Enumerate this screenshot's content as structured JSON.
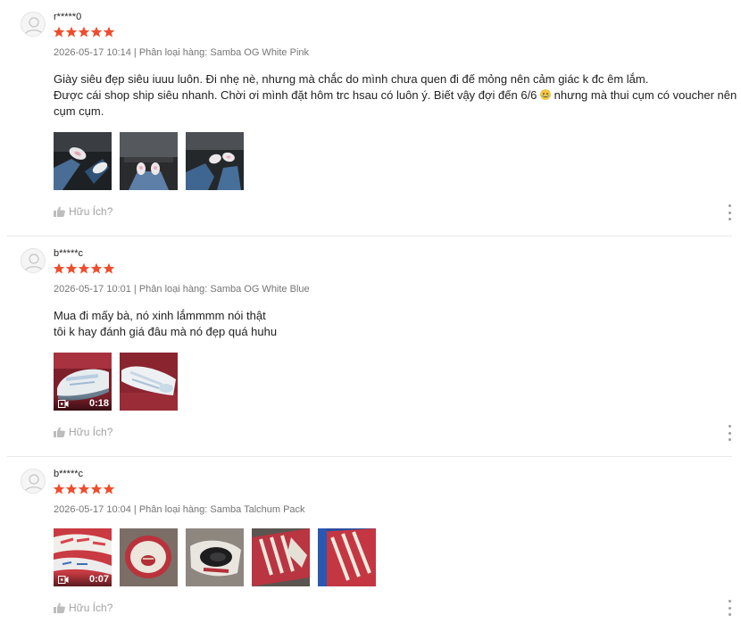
{
  "colors": {
    "star": "#ee4d2d",
    "meta": "#757575",
    "helpful": "#a3a3a3"
  },
  "reviews": [
    {
      "username": "r*****0",
      "rating": 5,
      "date": "2026-05-17 10:14",
      "separator": "|",
      "variation_label": "Phân loại hàng:",
      "variation": "Samba OG White Pink",
      "lines": [
        "Giày siêu đẹp siêu iuuu luôn. Đi nhẹ nè, nhưng mà chắc do mình chưa quen đi đế mỏng nên cảm giác k đc êm lắm.",
        "Được cái shop ship siêu nhanh. Chời ơi mình đặt hôm trc hsau có luôn ý. Biết vậy đợi đến 6/6",
        "cụm cụm."
      ],
      "line2_tail": " nhưng mà thui cụm có voucher nên",
      "emoji": "crying-face",
      "media": [
        {
          "type": "image",
          "name": "photo-sneakers-car-1"
        },
        {
          "type": "image",
          "name": "photo-sneakers-car-2"
        },
        {
          "type": "image",
          "name": "photo-sneakers-car-3"
        }
      ],
      "helpful_label": "Hữu Ích?"
    },
    {
      "username": "b*****c",
      "rating": 5,
      "date": "2026-05-17 10:01",
      "separator": "|",
      "variation_label": "Phân loại hàng:",
      "variation": "Samba OG White Blue",
      "lines": [
        "Mua đi mấy bà, nó xinh lắmmmm nói thật",
        "tôi k hay đánh giá đâu mà nó đẹp quá huhu"
      ],
      "media": [
        {
          "type": "video",
          "name": "video-sneakers-white-blue",
          "duration": "0:18"
        },
        {
          "type": "image",
          "name": "photo-sneakers-white-blue"
        }
      ],
      "helpful_label": "Hữu Ích?"
    },
    {
      "username": "b*****c",
      "rating": 5,
      "date": "2026-05-17 10:04",
      "separator": "|",
      "variation_label": "Phân loại hàng:",
      "variation": "Samba Talchum Pack",
      "lines": [],
      "media": [
        {
          "type": "video",
          "name": "video-sneakers-talchum",
          "duration": "0:07"
        },
        {
          "type": "image",
          "name": "photo-talchum-insole"
        },
        {
          "type": "image",
          "name": "photo-talchum-inside"
        },
        {
          "type": "image",
          "name": "photo-talchum-side"
        },
        {
          "type": "image",
          "name": "photo-talchum-stripes"
        }
      ],
      "helpful_label": "Hữu Ích?"
    }
  ]
}
